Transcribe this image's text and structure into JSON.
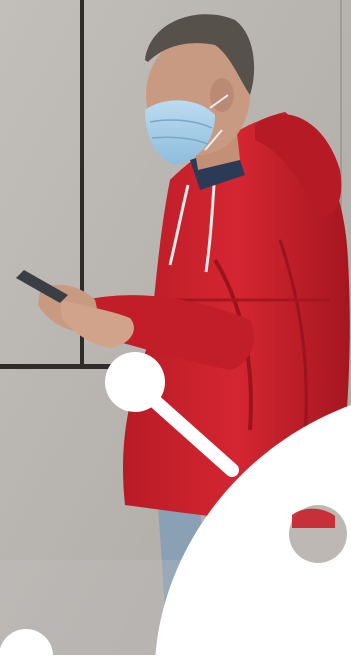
{
  "hero": {
    "image_subject": "man-wearing-face-mask-using-smartphone",
    "icons": {
      "network-node-large": "network-node-icon",
      "network-node-small": "network-node-icon"
    },
    "colors": {
      "wall": "#b9b5b1",
      "wall_dark": "#a9a5a0",
      "jacket": "#c8202b",
      "jacket_dark": "#9e1620",
      "mask": "#a9cfe8",
      "hair": "#555049",
      "skin": "#c99a82",
      "overlay": "#ffffff"
    }
  }
}
